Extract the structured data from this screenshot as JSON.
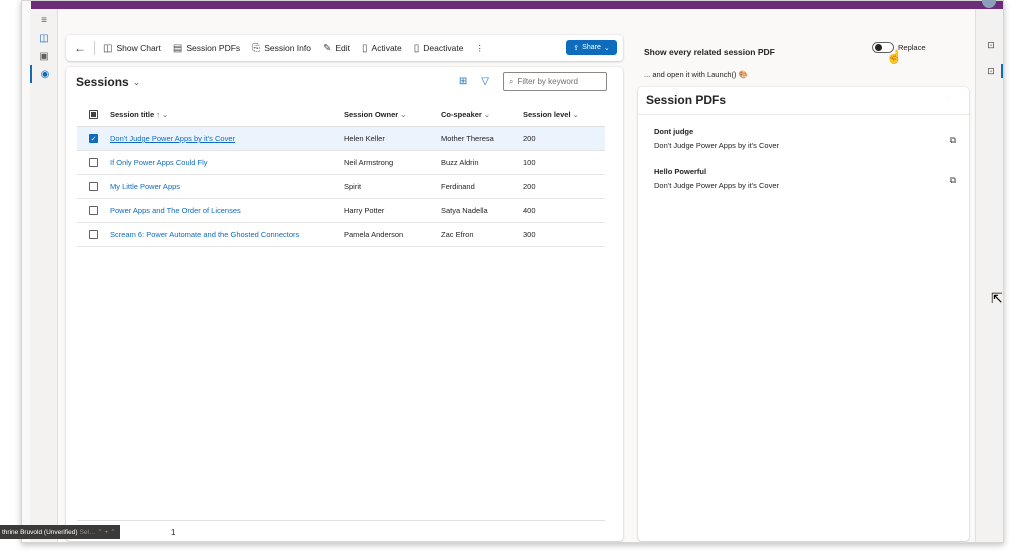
{
  "rail": {
    "items": [
      "≡",
      "◫",
      "▣",
      "◉"
    ]
  },
  "commandbar": {
    "back_label": "←",
    "show_chart": "Show Chart",
    "session_pdfs": "Session PDFs",
    "session_info": "Session Info",
    "edit": "Edit",
    "activate": "Activate",
    "deactivate": "Deactivate",
    "more": "⋮",
    "share": "Share"
  },
  "grid": {
    "title": "Sessions",
    "filter_placeholder": "Filter by keyword",
    "columns": {
      "title": "Session title",
      "title_sort": "↑ ⌄",
      "owner": "Session Owner",
      "owner_sort": "⌄",
      "cospeaker": "Co-speaker",
      "cospeaker_sort": "⌄",
      "level": "Session level",
      "level_sort": "⌄"
    },
    "rows": [
      {
        "title": "Don't Judge Power Apps by it's Cover",
        "owner": "Helen Keller",
        "cospeaker": "Mother Theresa",
        "level": "200"
      },
      {
        "title": "If Only Power Apps Could Fly",
        "owner": "Neil Armstrong",
        "cospeaker": "Buzz Aldrin",
        "level": "100"
      },
      {
        "title": "My Little Power Apps",
        "owner": "Spirit",
        "cospeaker": "Ferdinand",
        "level": "200"
      },
      {
        "title": "Power Apps and The Order of Licenses",
        "owner": "Harry Potter",
        "cospeaker": "Satya Nadella",
        "level": "400"
      },
      {
        "title": "Scream 6: Power Automate and the Ghosted Connectors",
        "owner": "Pamela Anderson",
        "cospeaker": "Zac Efron",
        "level": "300"
      }
    ],
    "footer_count": "1"
  },
  "user_tag": {
    "name": "thrine Bruvold (Unverified)",
    "rest": "Sel… ⌃ + ⌃"
  },
  "side_panel": {
    "heading": "Show every related session PDF",
    "subheading": "... and open it with Launch() 🎨",
    "toggle_label": "Replace",
    "card_title": "Session PDFs",
    "pdfs": [
      {
        "name": "Dont judge",
        "desc": "Don't Judge Power Apps by it's Cover"
      },
      {
        "name": "Hello Powerful",
        "desc": "Don't Judge Power Apps by it's Cover"
      }
    ]
  },
  "colors": {
    "brand": "#6b2d77",
    "accent": "#0f6cbd",
    "selected_row": "#ebf3fc"
  }
}
